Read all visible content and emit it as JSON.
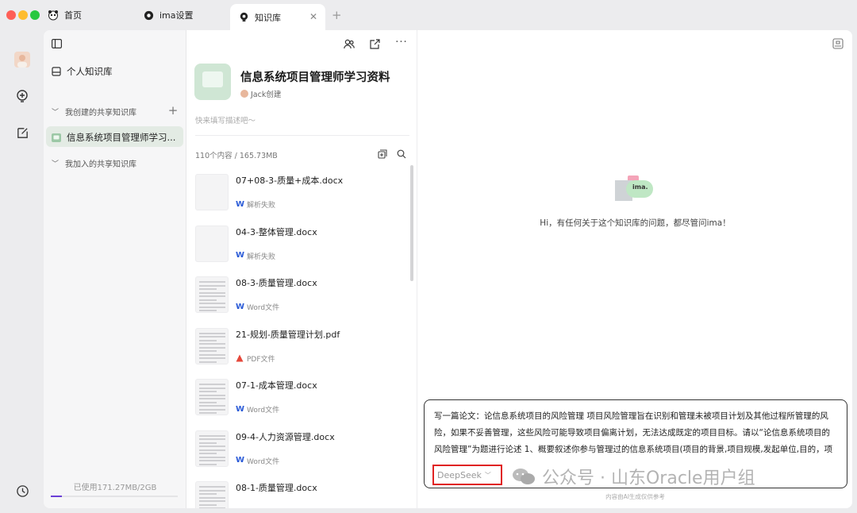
{
  "tabs": [
    {
      "label": "首页",
      "icon": "panda-icon"
    },
    {
      "label": "ima设置",
      "icon": "settings-icon"
    },
    {
      "label": "知识库",
      "icon": "knowledge-icon"
    }
  ],
  "sidebar": {
    "personal": "个人知识库",
    "created_section": "我创建的共享知识库",
    "active_kb": "信息系统项目管理师学习...",
    "joined_section": "我加入的共享知识库",
    "storage": "已使用171.27MB/2GB",
    "storage_fraction": 0.085
  },
  "kb": {
    "title": "信息系统项目管理师学习资料",
    "creator": "Jack创建",
    "desc_placeholder": "快来填写描述吧～",
    "stats": "110个内容 / 165.73MB"
  },
  "files": [
    {
      "name": "07+08-3-质量+成本.docx",
      "type": "word",
      "status": "解析失败"
    },
    {
      "name": "04-3-整体管理.docx",
      "type": "word",
      "status": "解析失败"
    },
    {
      "name": "08-3-质量管理.docx",
      "type": "word",
      "status": "Word文件"
    },
    {
      "name": "21-规划-质量管理计划.pdf",
      "type": "pdf",
      "status": "PDF文件"
    },
    {
      "name": "07-1-成本管理.docx",
      "type": "word",
      "status": "Word文件"
    },
    {
      "name": "09-4-人力资源管理.docx",
      "type": "word",
      "status": "Word文件"
    },
    {
      "name": "08-1-质量管理.docx",
      "type": "word",
      "status": ""
    }
  ],
  "chat": {
    "greeting": "Hi，有任何关于这个知识库的问题，都尽管问ima！",
    "logo_text": "ima.",
    "prompt": "写一篇论文：论信息系统项目的风险管理 项目风险管理旨在识别和管理未被项目计划及其他过程所管理的风险，如果不妥善管理，这些风险可能导致项目偏离计划，无法达成既定的项目目标。请以“论信息系统项目的风险管理”为题进行论述 1、概要叙述你参与管理过的信息系统项目(项目的背景,项目规模,发起单位,目的，项目内容，组织结构，项目周期，交付的成果等)，并说明你在其中承担的工作",
    "model": "DeepSeek",
    "watermark": "公众号 · 山东Oracle用户组",
    "footnote": "内容由AI生成仅供参考"
  }
}
